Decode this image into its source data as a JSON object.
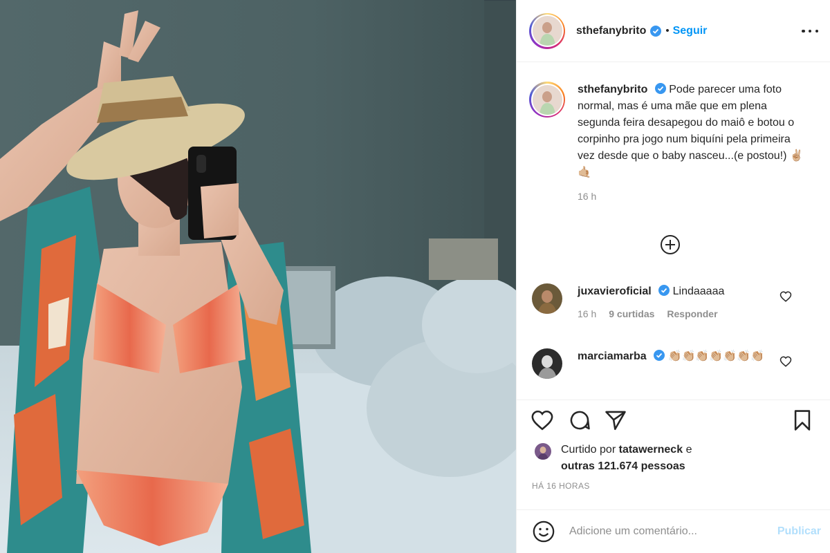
{
  "post": {
    "photo_description_icon": "selfie-photo",
    "author": {
      "username": "sthefanybrito",
      "verified": true,
      "follow_label": "Seguir",
      "separator": "•"
    },
    "caption": {
      "username": "sthefanybrito",
      "text": "Pode parecer uma foto normal, mas é uma mãe que em plena segunda feira desapegou do maiô e botou o corpinho pra jogo num biquíni pela primeira vez desde que o baby nasceu...(e postou!) ✌🏼🤙🏼",
      "time": "16 h"
    },
    "comments": [
      {
        "username": "juxavieroficial",
        "text": "Lindaaaaa",
        "time": "16 h",
        "likes": "9 curtidas",
        "reply_label": "Responder"
      },
      {
        "username": "marciamarba",
        "text": "👏🏼👏🏼👏🏼👏🏼👏🏼👏🏼👏🏼"
      }
    ],
    "likes": {
      "prefix": "Curtido por",
      "liker": "tatawerneck",
      "connector": "e",
      "others": "outras 121.674 pessoas"
    },
    "timestamp": "HÁ 16 HORAS",
    "add_comment": {
      "placeholder": "Adicione um comentário...",
      "publish_label": "Publicar"
    },
    "colors": {
      "link_blue": "#0095f6",
      "verified_blue": "#3897f0",
      "publish_disabled": "#b2dffc",
      "muted": "#8e8e8e"
    }
  }
}
